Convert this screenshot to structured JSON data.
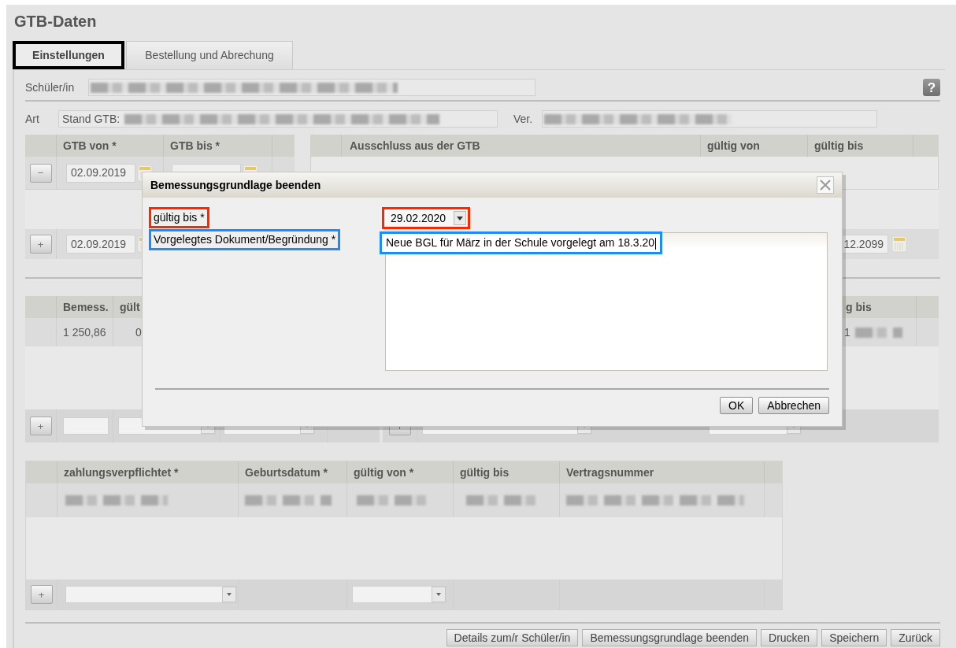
{
  "page_title": "GTB-Daten",
  "tabs": [
    {
      "label": "Einstellungen",
      "selected": true,
      "highlighted": true
    },
    {
      "label": "Bestellung und Abrechung",
      "selected": false,
      "highlighted": false
    }
  ],
  "help": "?",
  "student": {
    "label": "Schüler/in"
  },
  "art": {
    "label": "Art",
    "stand_label": "Stand GTB:",
    "ver_label": "Ver."
  },
  "gtb_table": {
    "columns": [
      "GTB von *",
      "GTB bis *"
    ],
    "remove": "−",
    "add": "+",
    "rows": [
      {
        "von": "02.09.2019"
      }
    ],
    "new_von": "02.09.2019"
  },
  "exclusion_table": {
    "columns": [
      "Ausschluss aus der GTB",
      "gültig von",
      "gültig bis"
    ],
    "new_bis": "12.2099"
  },
  "basis_table": {
    "columns": [
      "Bemess.",
      "gült"
    ],
    "rows": [
      [
        "1 250,86",
        "0"
      ]
    ],
    "add": "+"
  },
  "basis_table_right": {
    "columns": [
      "g bis"
    ],
    "rows": [
      [
        "1"
      ]
    ]
  },
  "payer_table": {
    "columns": [
      "zahlungsverpflichtet *",
      "Geburtsdatum *",
      "gültig von *",
      "gültig bis",
      "Vertragsnummer"
    ],
    "add": "+"
  },
  "footer_buttons": [
    "Details zum/r Schüler/in",
    "Bemessungsgrundlage beenden",
    "Drucken",
    "Speichern",
    "Zurück"
  ],
  "dialog": {
    "title": "Bemessungsgrundlage beenden",
    "fields": [
      {
        "kind": "select",
        "label": "gültig bis *",
        "value": "29.02.2020",
        "color": "#ff2600"
      },
      {
        "kind": "textarea",
        "label": "Vorgelegtes Dokument/Begründung *",
        "value": "Neue BGL für März in der Schule vorgelegt am 18.3.20",
        "color": "#1a8cff"
      }
    ],
    "buttons": [
      "OK",
      "Abbrechen"
    ]
  }
}
